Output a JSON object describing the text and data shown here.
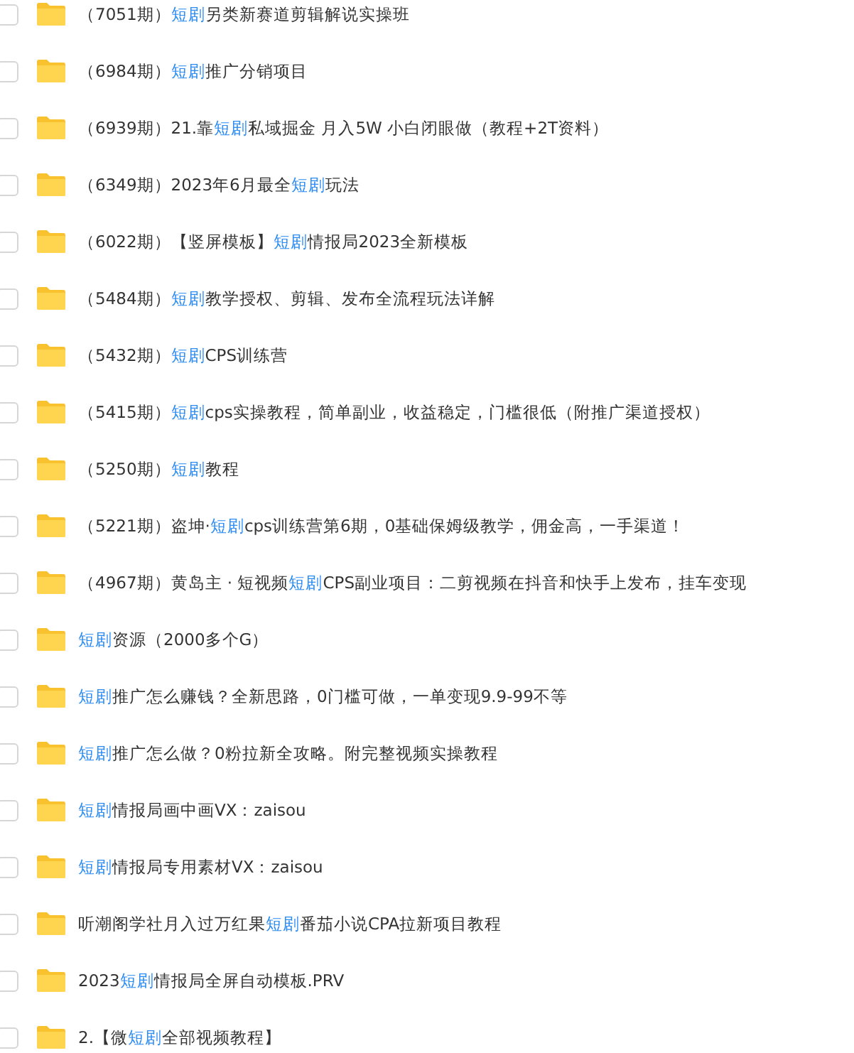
{
  "files": [
    {
      "checked": false,
      "name": [
        {
          "text": "（7051期）",
          "highlight": false
        },
        {
          "text": "短剧",
          "highlight": true
        },
        {
          "text": "另类新赛道剪辑解说实操班",
          "highlight": false
        }
      ]
    },
    {
      "checked": false,
      "name": [
        {
          "text": "（6984期）",
          "highlight": false
        },
        {
          "text": "短剧",
          "highlight": true
        },
        {
          "text": "推广分销项目",
          "highlight": false
        }
      ]
    },
    {
      "checked": false,
      "name": [
        {
          "text": "（6939期）21.靠",
          "highlight": false
        },
        {
          "text": "短剧",
          "highlight": true
        },
        {
          "text": "私域掘金 月入5W 小白闭眼做（教程+2T资料）",
          "highlight": false
        }
      ]
    },
    {
      "checked": false,
      "name": [
        {
          "text": "（6349期）2023年6月最全",
          "highlight": false
        },
        {
          "text": "短剧",
          "highlight": true
        },
        {
          "text": "玩法",
          "highlight": false
        }
      ]
    },
    {
      "checked": false,
      "name": [
        {
          "text": "（6022期）【竖屏模板】",
          "highlight": false
        },
        {
          "text": "短剧",
          "highlight": true
        },
        {
          "text": "情报局2023全新模板",
          "highlight": false
        }
      ]
    },
    {
      "checked": false,
      "name": [
        {
          "text": "（5484期）",
          "highlight": false
        },
        {
          "text": "短剧",
          "highlight": true
        },
        {
          "text": "教学授权、剪辑、发布全流程玩法详解",
          "highlight": false
        }
      ]
    },
    {
      "checked": false,
      "name": [
        {
          "text": "（5432期）",
          "highlight": false
        },
        {
          "text": "短剧",
          "highlight": true
        },
        {
          "text": "CPS训练营",
          "highlight": false
        }
      ]
    },
    {
      "checked": false,
      "name": [
        {
          "text": "（5415期）",
          "highlight": false
        },
        {
          "text": "短剧",
          "highlight": true
        },
        {
          "text": "cps实操教程，简单副业，收益稳定，门槛很低（附推广渠道授权）",
          "highlight": false
        }
      ]
    },
    {
      "checked": false,
      "name": [
        {
          "text": "（5250期）",
          "highlight": false
        },
        {
          "text": "短剧",
          "highlight": true
        },
        {
          "text": "教程",
          "highlight": false
        }
      ]
    },
    {
      "checked": false,
      "name": [
        {
          "text": "（5221期）盗坤·",
          "highlight": false
        },
        {
          "text": "短剧",
          "highlight": true
        },
        {
          "text": "cps训练营第6期，0基础保姆级教学，佣金高，一手渠道！",
          "highlight": false
        }
      ]
    },
    {
      "checked": false,
      "name": [
        {
          "text": "（4967期）黄岛主 · 短视频",
          "highlight": false
        },
        {
          "text": "短剧",
          "highlight": true
        },
        {
          "text": "CPS副业项目：二剪视频在抖音和快手上发布，挂车变现",
          "highlight": false
        }
      ]
    },
    {
      "checked": false,
      "name": [
        {
          "text": "短剧",
          "highlight": true
        },
        {
          "text": "资源（2000多个G）",
          "highlight": false
        }
      ]
    },
    {
      "checked": false,
      "name": [
        {
          "text": "短剧",
          "highlight": true
        },
        {
          "text": "推广怎么赚钱？全新思路，0门槛可做，一单变现9.9-99不等",
          "highlight": false
        }
      ]
    },
    {
      "checked": false,
      "name": [
        {
          "text": "短剧",
          "highlight": true
        },
        {
          "text": "推广怎么做？0粉拉新全攻略。附完整视频实操教程",
          "highlight": false
        }
      ]
    },
    {
      "checked": false,
      "name": [
        {
          "text": "短剧",
          "highlight": true
        },
        {
          "text": "情报局画中画VX：zaisou",
          "highlight": false
        }
      ]
    },
    {
      "checked": false,
      "name": [
        {
          "text": "短剧",
          "highlight": true
        },
        {
          "text": "情报局专用素材VX：zaisou",
          "highlight": false
        }
      ]
    },
    {
      "checked": false,
      "name": [
        {
          "text": "听潮阁学社月入过万红果",
          "highlight": false
        },
        {
          "text": "短剧",
          "highlight": true
        },
        {
          "text": "番茄小说CPA拉新项目教程",
          "highlight": false
        }
      ]
    },
    {
      "checked": false,
      "name": [
        {
          "text": "2023",
          "highlight": false
        },
        {
          "text": "短剧",
          "highlight": true
        },
        {
          "text": "情报局全屏自动模板.PRV",
          "highlight": false
        }
      ]
    },
    {
      "checked": false,
      "name": [
        {
          "text": "2.【微",
          "highlight": false
        },
        {
          "text": "短剧",
          "highlight": true
        },
        {
          "text": "全部视频教程】",
          "highlight": false
        }
      ]
    }
  ]
}
